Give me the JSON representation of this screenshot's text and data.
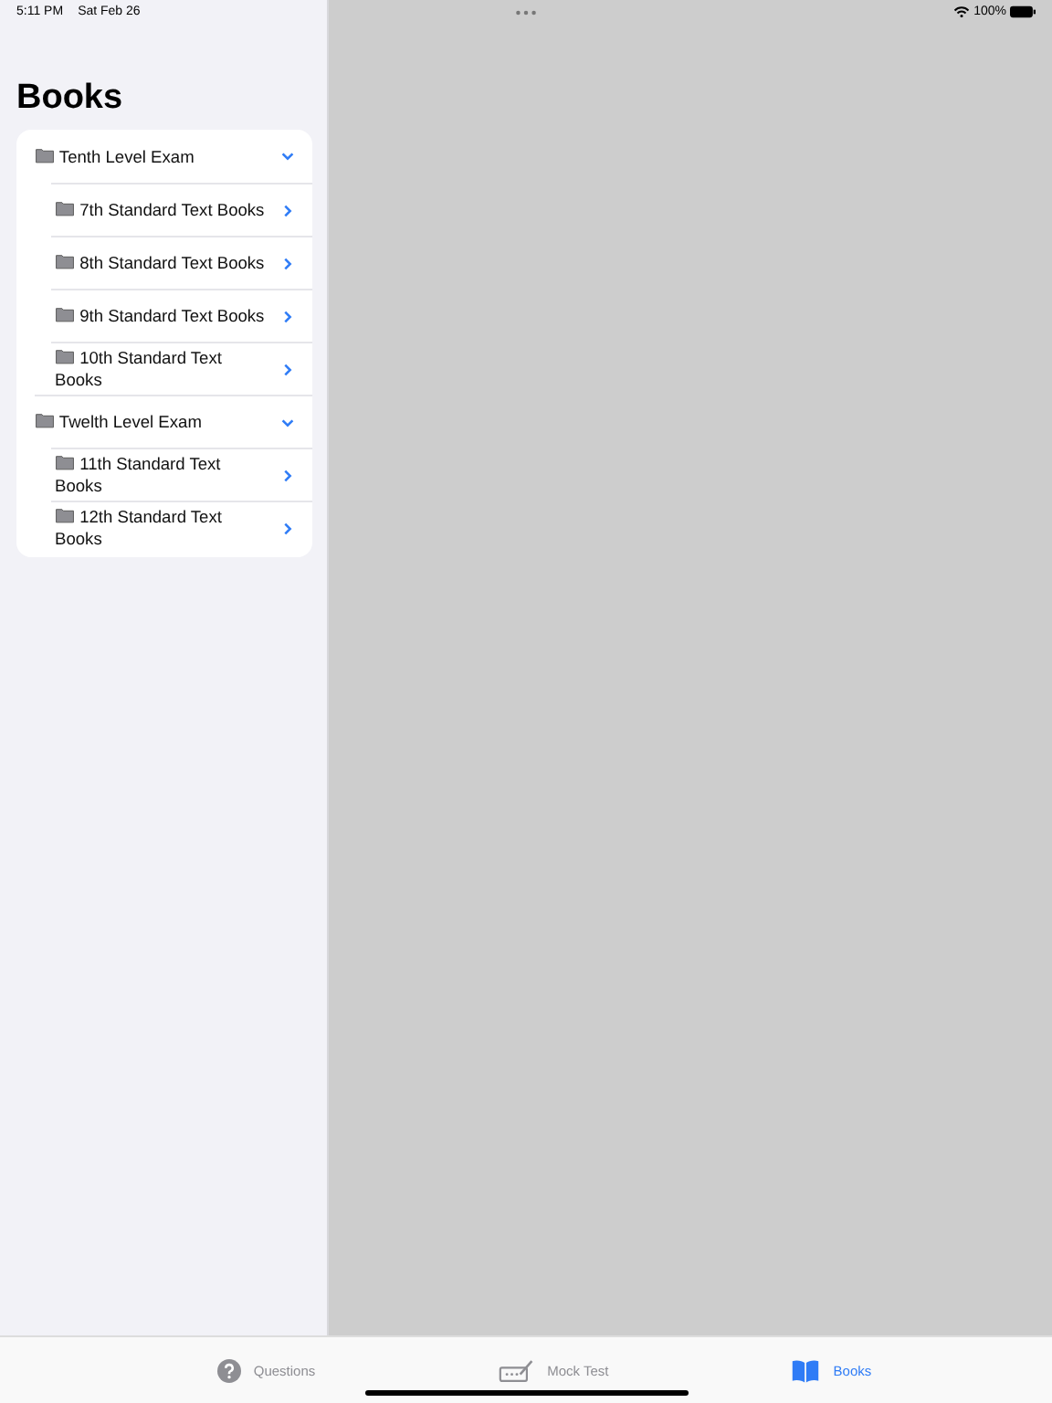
{
  "status_bar": {
    "time": "5:11 PM",
    "date": "Sat Feb 26",
    "battery": "100%"
  },
  "sidebar": {
    "title": "Books",
    "groups": [
      {
        "label": "Tenth Level Exam",
        "expanded": true,
        "children": [
          {
            "label": "7th Standard Text Books"
          },
          {
            "label": "8th Standard Text Books"
          },
          {
            "label": "9th Standard Text Books"
          },
          {
            "label": "10th Standard Text Books"
          }
        ]
      },
      {
        "label": "Twelth Level Exam",
        "expanded": true,
        "children": [
          {
            "label": "11th Standard Text Books"
          },
          {
            "label": "12th Standard Text Books"
          }
        ]
      }
    ]
  },
  "tab_bar": [
    {
      "kind": "questions",
      "label": "Questions",
      "selected": false
    },
    {
      "kind": "mock",
      "label": "Mock Test",
      "selected": false
    },
    {
      "kind": "books",
      "label": "Books",
      "selected": true
    }
  ]
}
